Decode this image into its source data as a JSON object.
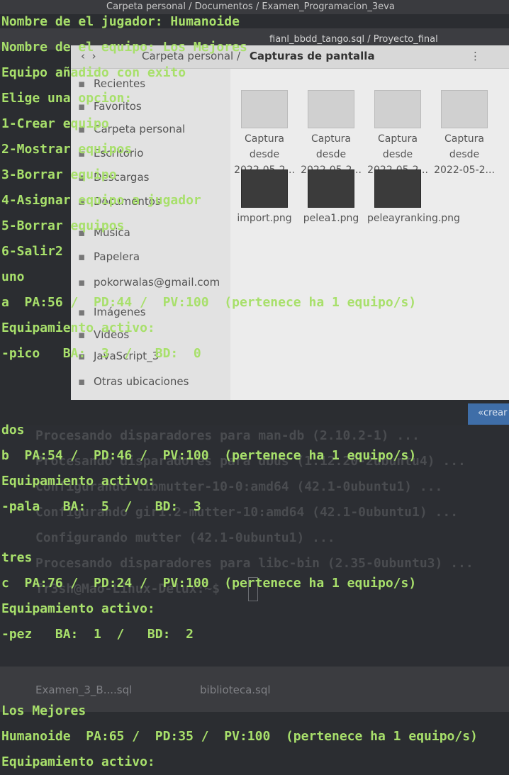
{
  "background": {
    "top_path": "Carpeta personal / Documentos / Examen_Programacion_3eva",
    "second_path": "fianl_bbdd_tango.sql / Proyecto_final",
    "file_manager": {
      "breadcrumb_parent": "Carpeta personal",
      "breadcrumb_current": "Capturas de pantalla",
      "sidebar": [
        "Recientes",
        "Favoritos",
        "Carpeta personal",
        "Escritorio",
        "Descargas",
        "Documentos",
        "Música",
        "Papelera",
        "pokorwalas@gmail.com",
        "Imágenes",
        "Vídeos",
        "JavaScript_3",
        "Otras ubicaciones"
      ],
      "files": [
        {
          "name": "Captura desde 2022-05-2...",
          "dark": false
        },
        {
          "name": "Captura desde 2022-05-2...",
          "dark": false
        },
        {
          "name": "Captura desde 2022-05-2...",
          "dark": false
        },
        {
          "name": "Captura desde 2022-05-2...",
          "dark": false
        },
        {
          "name": "import.png",
          "dark": true
        },
        {
          "name": "pelea1.png",
          "dark": true
        },
        {
          "name": "peleayranking.png",
          "dark": true
        }
      ]
    },
    "blue_tab_label": "«crear",
    "term_lines": [
      "Procesando disparadores para man-db (2.10.2-1) ...",
      "Procesando disparadores para dbus (1.12.20-2ubuntu4) ...",
      "Configurando libmutter-10-0:amd64 (42.1-0ubuntu1) ...",
      "Configurando gir1.2-mutter-10:amd64 (42.1-0ubuntu1) ...",
      "Configurando mutter (42.1-0ubuntu1) ...",
      "Procesando disparadores para libc-bin (2.35-0ubuntu3) ...",
      "fr3sh@Mao-Linux-Delux:~$"
    ],
    "bottom_tabs": [
      "Examen_3_B....sql",
      "biblioteca.sql"
    ]
  },
  "terminal": {
    "lines": [
      "Nombre de el jugador: Humanoide",
      "Nombre de el equipo: Los Mejores",
      "Equipo añadido con exito",
      "Elige una opcion:",
      "1-Crear equipo",
      "2-Mostrar equipos",
      "3-Borrar equipo",
      "4-Asignar equipo a jugador",
      "5-Borrar equipos",
      "6-Salir2",
      "uno",
      "a  PA:56 /  PD:44 /  PV:100  (pertenece ha 1 equipo/s)",
      "Equipamiento activo:",
      "-pico   BA:  3  /   BD:  0",
      "",
      "",
      "dos",
      "b  PA:54 /  PD:46 /  PV:100  (pertenece ha 1 equipo/s)",
      "Equipamiento activo:",
      "-pala   BA:  5  /   BD:  3",
      "",
      "tres",
      "c  PA:76 /  PD:24 /  PV:100  (pertenece ha 1 equipo/s)",
      "Equipamiento activo:",
      "-pez   BA:  1  /   BD:  2",
      "",
      "",
      "Los Mejores",
      "Humanoide  PA:65 /  PD:35 /  PV:100  (pertenece ha 1 equipo/s)",
      "Equipamiento activo:"
    ]
  }
}
